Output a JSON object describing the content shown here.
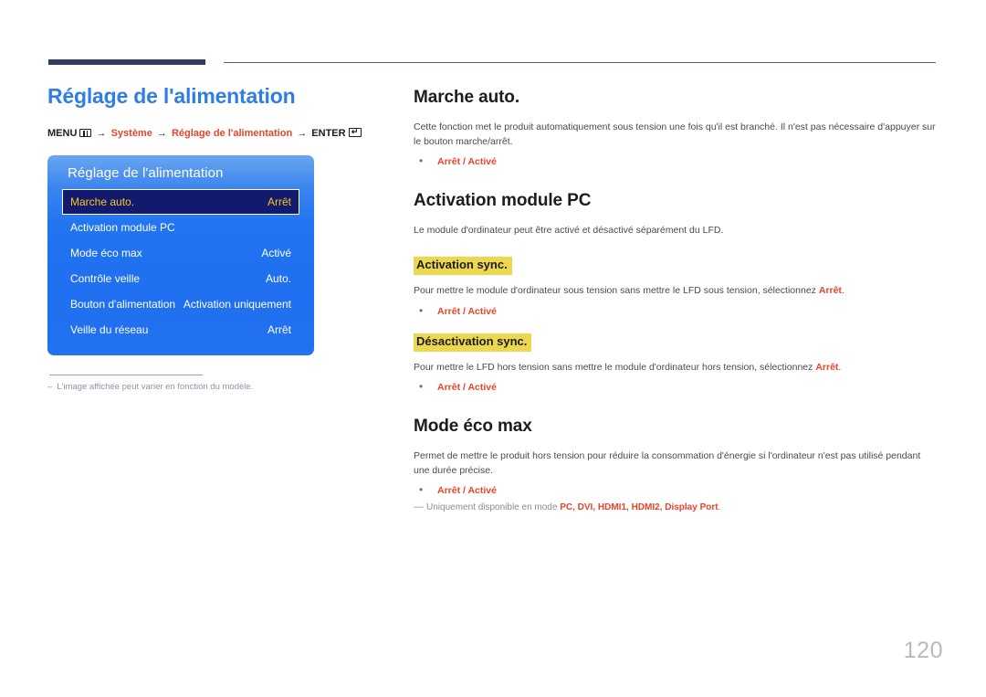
{
  "header": {
    "rule_color_thick": "#363b61",
    "rule_color_thin": "#5b5f80"
  },
  "left": {
    "page_title": "Réglage de l'alimentation",
    "title_color": "#2f7ee6",
    "breadcrumb": {
      "menu_label": "MENU",
      "menu_icon": "menu-grid-icon",
      "arrow": "→",
      "item1": "Système",
      "item2": "Réglage de l'alimentation",
      "enter_label": "ENTER",
      "enter_icon": "enter-key-icon",
      "accent_color": "#e8442a"
    },
    "osd": {
      "title": "Réglage de l'alimentation",
      "selected_index": 0,
      "highlight_bg": "#131a6e",
      "highlight_text": "#f2c81e",
      "rows": [
        {
          "label": "Marche auto.",
          "value": "Arrêt"
        },
        {
          "label": "Activation module PC",
          "value": ""
        },
        {
          "label": "Mode éco max",
          "value": "Activé"
        },
        {
          "label": "Contrôle veille",
          "value": "Auto."
        },
        {
          "label": "Bouton d'alimentation",
          "value": "Activation uniquement"
        },
        {
          "label": "Veille du réseau",
          "value": "Arrêt"
        }
      ]
    },
    "note": {
      "dash": "‒",
      "text": "L'image affichée peut varier en fonction du modèle."
    }
  },
  "right": {
    "sections": [
      {
        "heading": "Marche auto.",
        "paragraph": "Cette fonction met le produit automatiquement sous tension une fois qu'il est branché. Il n'est pas nécessaire d'appuyer sur le bouton marche/arrêt.",
        "bullet": "Arrêt / Activé"
      },
      {
        "heading": "Activation module PC",
        "paragraph": "Le module d'ordinateur peut être activé et désactivé séparément du LFD."
      }
    ],
    "sync_on": {
      "highlight_heading": "Activation sync.",
      "paragraph_pre": "Pour mettre le module d'ordinateur sous tension sans mettre le LFD sous tension, sélectionnez ",
      "paragraph_bold": "Arrêt",
      "paragraph_post": ".",
      "bullet": "Arrêt / Activé"
    },
    "sync_off": {
      "highlight_heading": "Désactivation sync.",
      "paragraph_pre": "Pour mettre le LFD hors tension sans mettre le module d'ordinateur hors tension, sélectionnez ",
      "paragraph_bold": "Arrêt",
      "paragraph_post": ".",
      "bullet": "Arrêt / Activé"
    },
    "eco": {
      "heading": "Mode éco max",
      "paragraph": "Permet de mettre le produit hors tension pour réduire la consommation d'énergie si l'ordinateur n'est pas utilisé pendant une durée précise.",
      "bullet": "Arrêt / Activé",
      "footnote_dash": "―",
      "footnote_pre": "Uniquement disponible en mode ",
      "footnote_modes": "PC, DVI, HDMI1, HDMI2, Display Port",
      "footnote_post": "."
    },
    "bullet_char": "•",
    "highlight_color": "#ebd84f",
    "accent_color": "#e8442a"
  },
  "footer": {
    "page_number": "120"
  }
}
